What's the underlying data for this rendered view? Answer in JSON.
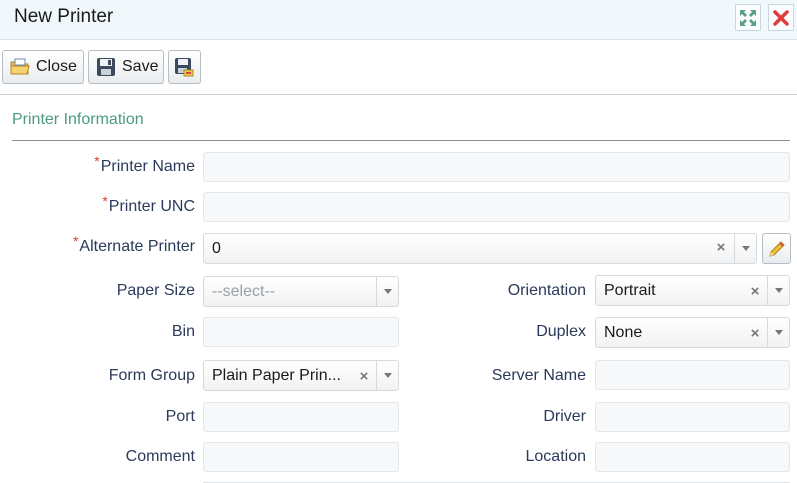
{
  "window": {
    "title": "New Printer"
  },
  "toolbar": {
    "close_label": "Close",
    "save_label": "Save"
  },
  "section": {
    "title": "Printer Information"
  },
  "fields": {
    "printer_name": {
      "label": "Printer Name",
      "required_mark": "*",
      "value": ""
    },
    "printer_unc": {
      "label": "Printer UNC",
      "required_mark": "*",
      "value": ""
    },
    "alternate_printer": {
      "label": "Alternate Printer",
      "required_mark": "*",
      "value": "0"
    },
    "paper_size": {
      "label": "Paper Size",
      "value": "--select--"
    },
    "orientation": {
      "label": "Orientation",
      "value": "Portrait"
    },
    "bin": {
      "label": "Bin",
      "value": ""
    },
    "duplex": {
      "label": "Duplex",
      "value": "None"
    },
    "form_group": {
      "label": "Form Group",
      "value": "Plain Paper Prin..."
    },
    "server_name": {
      "label": "Server Name",
      "value": ""
    },
    "port": {
      "label": "Port",
      "value": ""
    },
    "driver": {
      "label": "Driver",
      "value": ""
    },
    "comment": {
      "label": "Comment",
      "value": ""
    },
    "location": {
      "label": "Location",
      "value": ""
    }
  },
  "icons": {
    "maximize": "expand-arrows-icon",
    "close_window": "red-x-icon",
    "close_button": "folder-icon",
    "save_button": "floppy-disk-icon",
    "save_close_button": "save-and-close-icon",
    "edit": "pencil-icon"
  },
  "colors": {
    "accent": "#4a9a86",
    "required": "#d93a3a",
    "label": "#2b3a5a",
    "titlebar_bg": "#f1f8fb"
  }
}
